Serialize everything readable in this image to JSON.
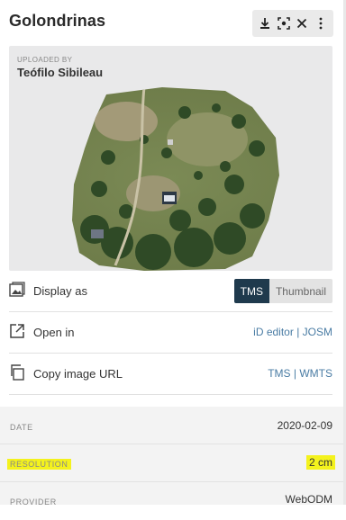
{
  "header": {
    "title": "Golondrinas",
    "tools": [
      {
        "icon": "download-icon"
      },
      {
        "icon": "focus-icon"
      },
      {
        "icon": "close-icon"
      },
      {
        "icon": "more-vertical-icon"
      }
    ]
  },
  "image_card": {
    "uploaded_by_label": "UPLOADED BY",
    "uploader": "Teófilo Sibileau",
    "image_icon": "aerial-orthophoto"
  },
  "actions": [
    {
      "icon": "image-icon",
      "label": "Display as",
      "toggle": {
        "options": [
          "TMS",
          "Thumbnail"
        ],
        "selected": "TMS"
      }
    },
    {
      "icon": "external-link-icon",
      "label": "Open in",
      "links": [
        "iD editor",
        "JOSM"
      ]
    },
    {
      "icon": "copy-icon",
      "label": "Copy image URL",
      "links": [
        "TMS",
        "WMTS"
      ]
    }
  ],
  "metadata": {
    "rows": [
      {
        "key": "DATE",
        "value": "2020-02-09"
      },
      {
        "key": "RESOLUTION",
        "value": "2 cm"
      },
      {
        "key": "PROVIDER",
        "value": "WebODM"
      }
    ],
    "highlight_color": "#f4f21d"
  },
  "colors": {
    "accent_dark": "#1f3a4d",
    "link": "#4a7ca4"
  }
}
